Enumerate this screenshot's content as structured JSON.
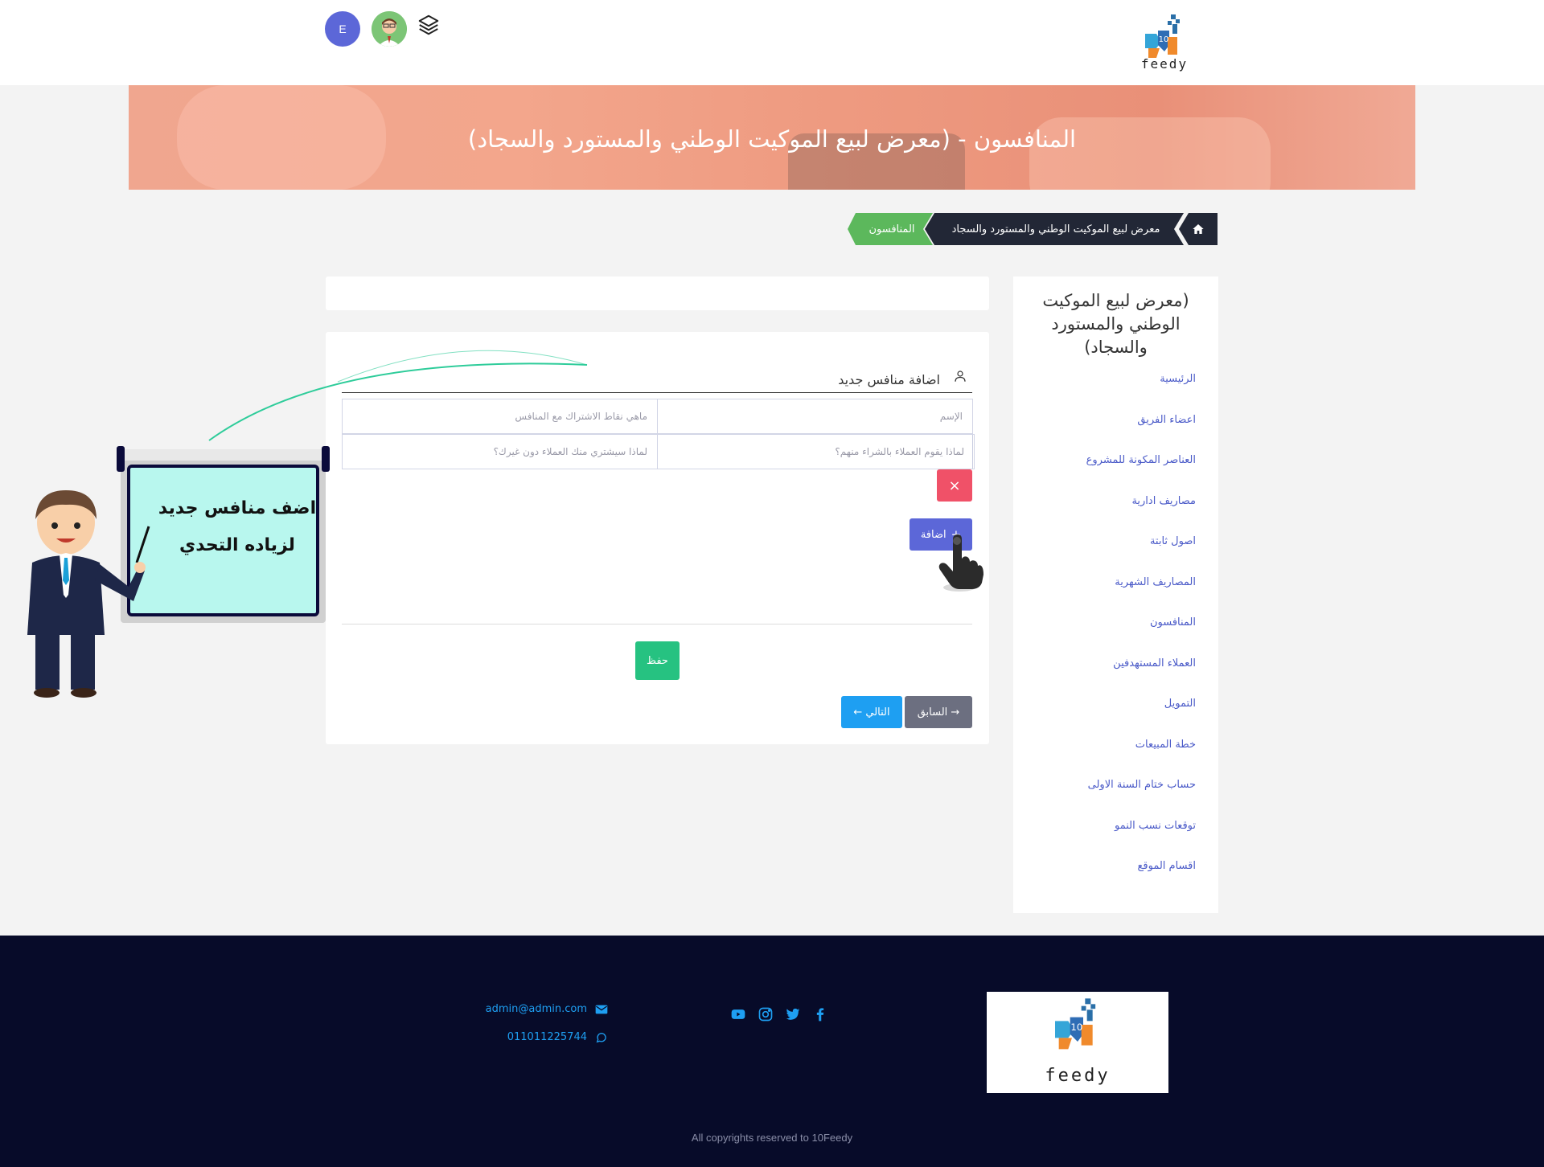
{
  "header": {
    "logo_text": "feedy",
    "logo_number": "10",
    "avatar_letter": "E"
  },
  "hero": {
    "title": "المنافسون - (معرض لبيع الموكيت الوطني والمستورد والسجاد)"
  },
  "breadcrumb": {
    "project": "معرض لبيع الموكيت الوطني والمستورد والسجاد",
    "current": "المنافسون"
  },
  "sidebar": {
    "title": "(معرض لبيع الموكيت الوطني والمستورد والسجاد)",
    "items": [
      {
        "label": "الرئيسية"
      },
      {
        "label": "اعضاء الفريق"
      },
      {
        "label": "العناصر المكونة للمشروع"
      },
      {
        "label": "مصاريف ادارية"
      },
      {
        "label": "اصول ثابتة"
      },
      {
        "label": "المصاريف الشهرية"
      },
      {
        "label": "المنافسون"
      },
      {
        "label": "العملاء المستهدفين"
      },
      {
        "label": "التمويل"
      },
      {
        "label": "خطة المبيعات"
      },
      {
        "label": "حساب ختام السنة الاولى"
      },
      {
        "label": "توقعات نسب النمو"
      },
      {
        "label": "اقسام الموقع"
      }
    ]
  },
  "form": {
    "section_label": "اضافة منافس جديد",
    "fields": {
      "name_placeholder": "الإسم",
      "points_placeholder": "ماهي نقاط الاشتراك مع المنافس",
      "why_buy_placeholder": "لماذا يقوم العملاء بالشراء منهم؟",
      "why_you_placeholder": "لماذا سيشتري منك العملاء دون غيرك؟"
    },
    "remove_label": "×",
    "add_label": "اضافة",
    "save_label": "حفظ",
    "prev_label": "السابق",
    "next_label": "التالي"
  },
  "illustration": {
    "line1": "اضف منافس جديد",
    "line2": "لزياده التحدي"
  },
  "footer": {
    "email": "admin@admin.com",
    "phone": "011011225744",
    "copyright": "All copyrights reserved to 10Feedy",
    "social_icons": [
      "youtube-icon",
      "instagram-icon",
      "twitter-icon",
      "facebook-icon"
    ]
  },
  "colors": {
    "primary": "#5c67d8",
    "danger": "#f05168",
    "success": "#26c281",
    "info": "#1e9ff2",
    "breadcrumb_dark": "#222736",
    "breadcrumb_active": "#5cb85c",
    "footer_bg": "#070b29"
  }
}
